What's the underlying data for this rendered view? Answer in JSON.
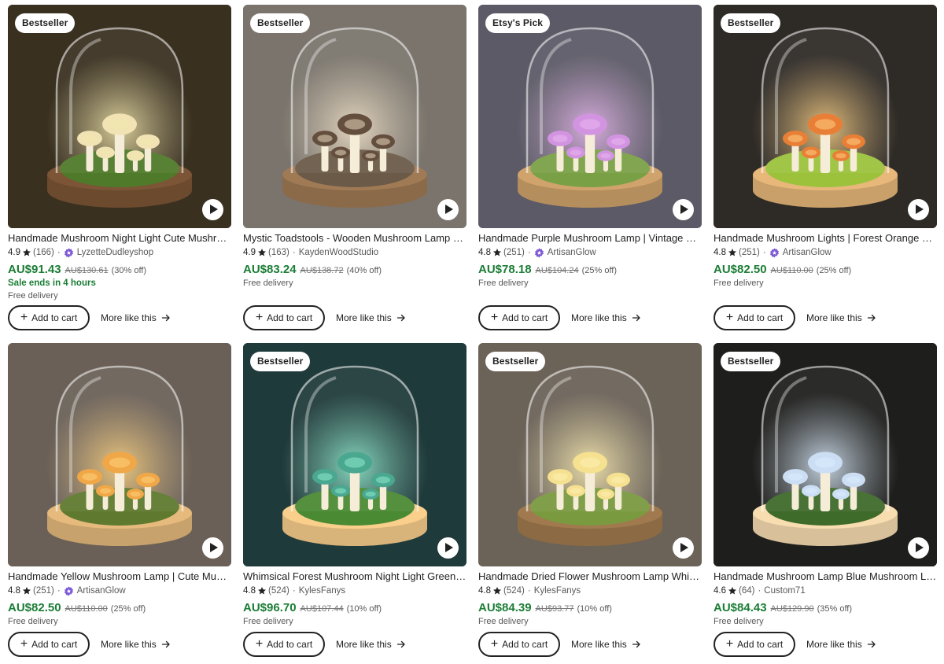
{
  "cards": [
    {
      "badge": "Bestseller",
      "title": "Handmade Mushroom Night Light Cute Mushroom Lamp",
      "rating": "4.9",
      "reviews": "(166)",
      "star_seller": true,
      "shop": "LyzetteDudleyshop",
      "price": "AU$91.43",
      "original_price": "AU$130.61",
      "discount": "(30% off)",
      "sale_note": "Sale ends in 4 hours",
      "delivery": "Free delivery",
      "cart_label": "Add to cart",
      "more_label": "More like this",
      "image": {
        "bg": "#3a3020",
        "glow": "#f2e6a8",
        "cap": "#f1e2b0",
        "moss": "#4f7a2a",
        "base": "#6b4a2e"
      }
    },
    {
      "badge": "Bestseller",
      "title": "Mystic Toadstools - Wooden Mushroom Lamp Night Light",
      "rating": "4.9",
      "reviews": "(163)",
      "star_seller": false,
      "shop": "KaydenWoodStudio",
      "price": "AU$83.24",
      "original_price": "AU$138.72",
      "discount": "(40% off)",
      "sale_note": "",
      "delivery": "Free delivery",
      "cart_label": "Add to cart",
      "more_label": "More like this",
      "image": {
        "bg": "#7a746c",
        "glow": "#f3e3c8",
        "cap": "#5b4332",
        "moss": "#6b5a48",
        "base": "#8b6a4a"
      }
    },
    {
      "badge": "Etsy's Pick",
      "title": "Handmade Purple Mushroom Lamp | Vintage Style Glass Dome",
      "rating": "4.8",
      "reviews": "(251)",
      "star_seller": true,
      "shop": "ArtisanGlow",
      "price": "AU$78.18",
      "original_price": "AU$104.24",
      "discount": "(25% off)",
      "sale_note": "",
      "delivery": "Free delivery",
      "cart_label": "Add to cart",
      "more_label": "More like this",
      "image": {
        "bg": "#5c5a66",
        "glow": "#e9b4ef",
        "cap": "#d08ee0",
        "moss": "#7aa046",
        "base": "#b58e5e"
      }
    },
    {
      "badge": "Bestseller",
      "title": "Handmade Mushroom Lights | Forest Orange Mushroom Lamp",
      "rating": "4.8",
      "reviews": "(251)",
      "star_seller": true,
      "shop": "ArtisanGlow",
      "price": "AU$82.50",
      "original_price": "AU$110.00",
      "discount": "(25% off)",
      "sale_note": "",
      "delivery": "Free delivery",
      "cart_label": "Add to cart",
      "more_label": "More like this",
      "image": {
        "bg": "#2e2a26",
        "glow": "#ffd180",
        "cap": "#e8782a",
        "moss": "#9cc23c",
        "base": "#c9a06a"
      }
    },
    {
      "badge": "",
      "title": "Handmade Yellow Mushroom Lamp | Cute Mushroom Night Light",
      "rating": "4.8",
      "reviews": "(251)",
      "star_seller": true,
      "shop": "ArtisanGlow",
      "price": "AU$82.50",
      "original_price": "AU$110.00",
      "discount": "(25% off)",
      "sale_note": "",
      "delivery": "Free delivery",
      "cart_label": "Add to cart",
      "more_label": "More like this",
      "image": {
        "bg": "#6a6058",
        "glow": "#ffd27a",
        "cap": "#f0a23c",
        "moss": "#5f7a2e",
        "base": "#c7a26c"
      }
    },
    {
      "badge": "Bestseller",
      "title": "Whimsical Forest Mushroom Night Light Green Glow Lamp",
      "rating": "4.8",
      "reviews": "(524)",
      "star_seller": false,
      "shop": "KylesFanys",
      "price": "AU$96.70",
      "original_price": "AU$107.44",
      "discount": "(10% off)",
      "sale_note": "",
      "delivery": "Free delivery",
      "cart_label": "Add to cart",
      "more_label": "More like this",
      "image": {
        "bg": "#1f3a3a",
        "glow": "#8ff0d0",
        "cap": "#3fa28a",
        "moss": "#4a8a32",
        "base": "#d9b47a"
      }
    },
    {
      "badge": "Bestseller",
      "title": "Handmade Dried Flower Mushroom Lamp Whimsical Decor",
      "rating": "4.8",
      "reviews": "(524)",
      "star_seller": false,
      "shop": "KylesFanys",
      "price": "AU$84.39",
      "original_price": "AU$93.77",
      "discount": "(10% off)",
      "sale_note": "",
      "delivery": "Free delivery",
      "cart_label": "Add to cart",
      "more_label": "More like this",
      "image": {
        "bg": "#6b6258",
        "glow": "#fff0b0",
        "cap": "#f5e08a",
        "moss": "#7a9a40",
        "base": "#8b6a44"
      }
    },
    {
      "badge": "Bestseller",
      "title": "Handmade Mushroom Lamp Blue Mushroom Light Gift",
      "rating": "4.6",
      "reviews": "(64)",
      "star_seller": false,
      "shop": "Custom71",
      "price": "AU$84.43",
      "original_price": "AU$129.90",
      "discount": "(35% off)",
      "sale_note": "",
      "delivery": "Free delivery",
      "cart_label": "Add to cart",
      "more_label": "More like this",
      "image": {
        "bg": "#1e1e1c",
        "glow": "#dceeff",
        "cap": "#c8dcf4",
        "moss": "#3e6a2a",
        "base": "#d8c09a"
      }
    }
  ]
}
